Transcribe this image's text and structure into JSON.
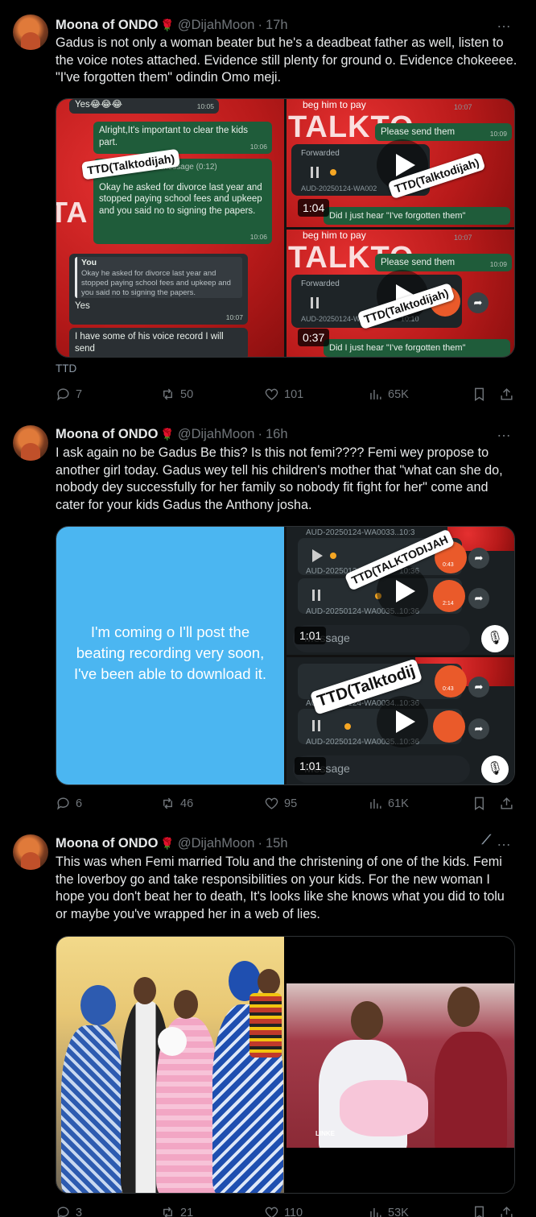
{
  "tweets": [
    {
      "author": "Moona of ONDO",
      "handle": "@DijahMoon",
      "time": "17h",
      "text": "Gadus is not only a woman beater but he's a deadbeat father as well, listen to the voice notes attached. Evidence still plenty for ground o. Evidence chokeeee. \"I've forgotten them\" odindin Omo meji.",
      "caption": "TTD",
      "replies": "7",
      "reposts": "50",
      "likes": "101",
      "views": "65K",
      "media": {
        "chat": {
          "yes": "Yes😂😂😂",
          "t1": "10:05",
          "msg1": "Alright,It's important to clear the kids part.",
          "t2": "10:06",
          "voice": "Voice message (0:12)",
          "msg2": "Okay he asked for divorce last year and stopped paying school fees and upkeep and you said no to signing the papers.",
          "t3": "10:06",
          "quote_name": "You",
          "quote": "Okay he asked for divorce last year and stopped paying school fees and upkeep and you said no to signing the papers.",
          "reply": "Yes",
          "t4": "10:07",
          "msg3": "I have some of his voice record I will send",
          "watermark": "TTD(Talktodijah)"
        },
        "video1": {
          "top": "beg him to pay",
          "bubble": "Please send them",
          "bt": "10:09",
          "fwd": "Forwarded",
          "file": "AUD-20250124-WA002",
          "q": "Did I just hear \"I've forgotten them\"",
          "duration": "1:04",
          "wm": "TTD(Talktodijah)",
          "banner": "TALKTO",
          "clock": "10:07"
        },
        "video2": {
          "top": "beg him to pay",
          "bubble": "Please send them",
          "bt": "10:09",
          "fwd": "Forwarded",
          "file": "AUD-20250124-WA002",
          "ft": "10:10",
          "q": "Did I just hear \"I've forgotten them\"",
          "duration": "0:37",
          "wm": "TTD(Talktodijah)",
          "banner": "TALKTO",
          "clock": "10:07"
        }
      }
    },
    {
      "author": "Moona of ONDO",
      "handle": "@DijahMoon",
      "time": "16h",
      "text": "I ask again no be Gadus Be this? Is this not femi???? Femi wey propose to another girl today. Gadus wey tell his children's mother that \"what can she do, nobody dey successfully for her family so nobody fit fight for her\" come and cater for your kids Gadus the Anthony josha.",
      "replies": "6",
      "reposts": "46",
      "likes": "95",
      "views": "61K",
      "media": {
        "card_text": "I'm coming o I'll post the beating recording very soon, I've been able to download it.",
        "video1": {
          "file1": "AUD-20250124-WA0033...",
          "t1": "10:3",
          "file2": "AUD-20250124",
          "t2": "10:36",
          "file3": "AUD-20250124-WA0035...",
          "t3": "10:36",
          "msg": "Message",
          "duration": "1:01",
          "wm": "TTD(TALKTODIJAH",
          "o1": "0:43",
          "o2": "2:14"
        },
        "video2": {
          "file1": "AUD-20250124-WA0034...",
          "t1": "10:36",
          "file2": "AUD-20250124-WA0035...",
          "t2": "10:36",
          "msg": "Message",
          "duration": "1:01",
          "wm": "TTD(Talktodij",
          "o1": "0:43"
        }
      }
    },
    {
      "author": "Moona of ONDO",
      "handle": "@DijahMoon",
      "time": "15h",
      "text": "This was when Femi married Tolu and the christening of one of the kids. Femi the loverboy go and take responsibilities on your kids. For the new woman I hope you don't beat her to death, It's looks like she knows what you did to tolu or maybe you've wrapped her in a web of lies.",
      "replies": "3",
      "reposts": "21",
      "likes": "110",
      "views": "53K",
      "media": {
        "photo_mark": "LINKE"
      }
    }
  ],
  "icons": {
    "more": "…",
    "rose": "🌹"
  },
  "colors": {
    "background": "#000000",
    "muted": "#71767b",
    "text": "#e7e9ea",
    "border": "#2f3336",
    "card_blue": "#4bb6f1"
  }
}
